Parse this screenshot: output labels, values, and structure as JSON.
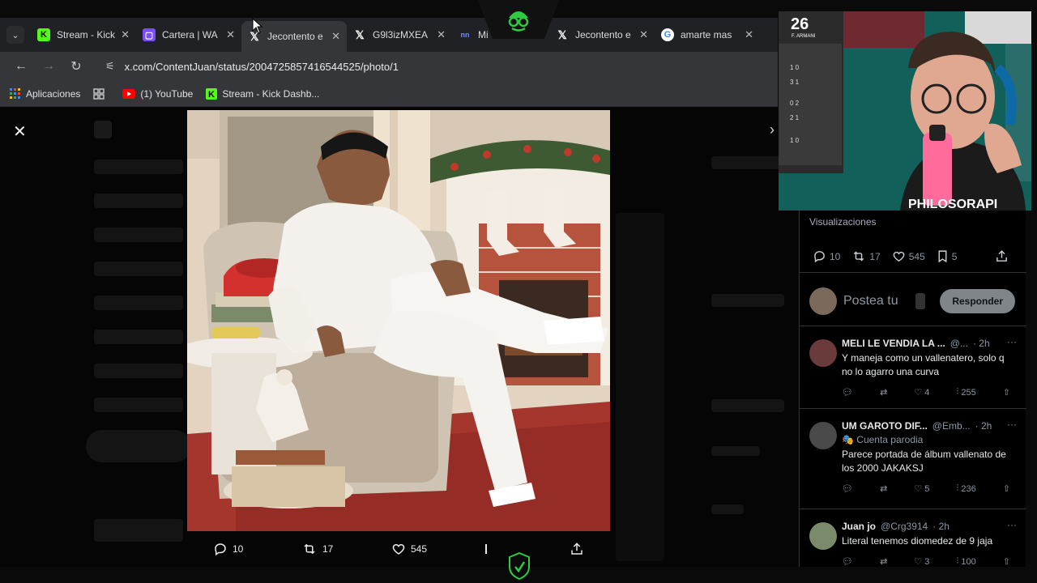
{
  "browser": {
    "tabs": [
      {
        "title": "Stream - Kick",
        "icon": "kick-icon",
        "color": "#53fc18"
      },
      {
        "title": "Cartera | WA",
        "icon": "cartera-icon",
        "color": "#7c4dff"
      },
      {
        "title": "Jecontento e",
        "icon": "x-icon",
        "color": "#ffffff",
        "active": true
      },
      {
        "title": "G9l3izMXEA",
        "icon": "x-icon",
        "color": "#ffffff"
      },
      {
        "title": "Mi",
        "icon": "mi-icon",
        "color": "#3b5bdb"
      },
      {
        "title": "Jecontento e",
        "icon": "x-icon",
        "color": "#ffffff"
      },
      {
        "title": "amarte mas",
        "icon": "google-icon",
        "color": "#4285f4"
      }
    ],
    "url": "x.com/ContentJuan/status/2004725857416544525/photo/1",
    "bookmarks": [
      {
        "label": "Aplicaciones",
        "icon": "apps-icon"
      },
      {
        "label": "",
        "icon": "grid-icon"
      },
      {
        "label": "(1) YouTube",
        "icon": "youtube-icon"
      },
      {
        "label": "Stream - Kick Dashb...",
        "icon": "kick-icon"
      }
    ]
  },
  "photo_actions": {
    "replies": "10",
    "reposts": "17",
    "likes": "545"
  },
  "panel": {
    "views_label": "Visualizaciones",
    "stats": {
      "replies": "10",
      "reposts": "17",
      "likes": "545",
      "bookmarks": "5"
    },
    "reply_placeholder": "Postea tu",
    "reply_button": "Responder",
    "replies": [
      {
        "name": "MELI LE VENDIA LA ...",
        "handle": "@...",
        "time": "· 2h",
        "text": "Y maneja como un vallenatero, solo q no lo agarro una curva",
        "sub": "",
        "reposts": "",
        "likes": "4",
        "views": "255",
        "avatar_color": "#6b3b3b"
      },
      {
        "name": "UM GAROTO DIF...",
        "handle": "@Emb...",
        "time": "· 2h",
        "sub": "🎭 Cuenta parodia",
        "text": "Parece portada de álbum vallenato de los 2000 JAKAKSJ",
        "reposts": "",
        "likes": "5",
        "views": "236",
        "avatar_color": "#4a4a4a"
      },
      {
        "name": "Juan jo",
        "handle": "@Crg3914",
        "time": "· 2h",
        "sub": "",
        "text": "Literal tenemos diomedez de 9 jaja",
        "reposts": "",
        "likes": "3",
        "views": "100",
        "avatar_color": "#7a8a6a"
      }
    ]
  },
  "webcam": {
    "shirt_text": "PHILOSORAPI",
    "poster_text": "F. ARMANI"
  }
}
